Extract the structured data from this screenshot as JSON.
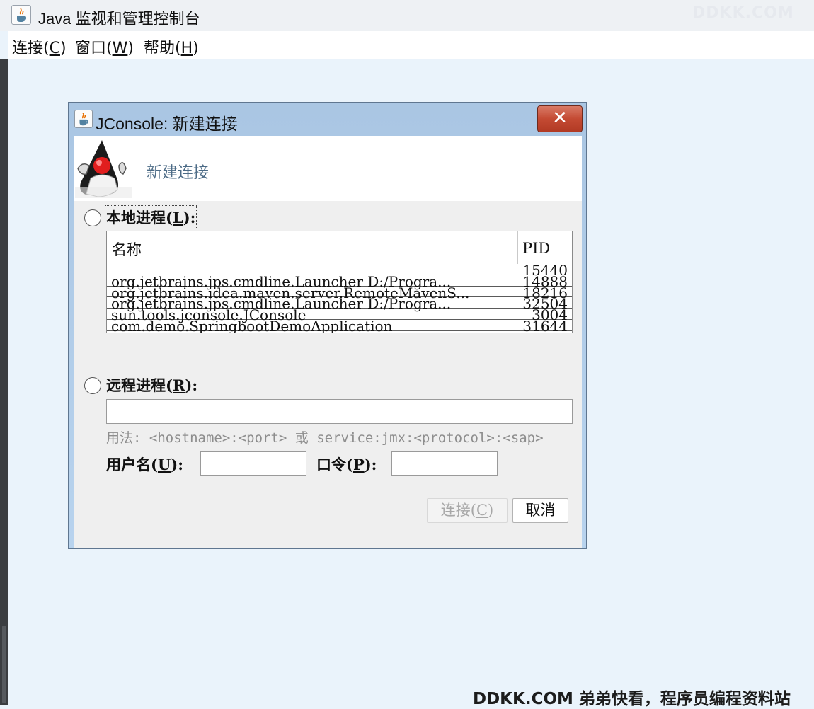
{
  "window": {
    "title": "Java 监视和管理控制台",
    "watermark_top": "DDKK.COM"
  },
  "menubar": {
    "items": [
      {
        "text": "连接(",
        "mnemonic": "C",
        "close": ")"
      },
      {
        "text": "窗口(",
        "mnemonic": "W",
        "close": ")"
      },
      {
        "text": "帮助(",
        "mnemonic": "H",
        "close": ")"
      }
    ]
  },
  "dialog": {
    "title": "JConsole: 新建连接",
    "close_glyph": "✕",
    "header_title": "新建连接",
    "local": {
      "label_pre": "本地进程(",
      "mnemonic": "L",
      "label_post": "):",
      "columns": {
        "name": "名称",
        "pid": "PID"
      },
      "rows": [
        {
          "name": "",
          "pid": "15440"
        },
        {
          "name": "org.jetbrains.jps.cmdline.Launcher D:/Progra...",
          "pid": "14888"
        },
        {
          "name": "org.jetbrains.idea.maven.server.RemoteMavenS...",
          "pid": "18216"
        },
        {
          "name": "org.jetbrains.jps.cmdline.Launcher D:/Progra...",
          "pid": "32504"
        },
        {
          "name": "sun.tools.jconsole.JConsole",
          "pid": "3004"
        },
        {
          "name": "com.demo.SpringbootDemoApplication",
          "pid": "31644"
        }
      ]
    },
    "remote": {
      "label_pre": "远程进程(",
      "mnemonic": "R",
      "label_post": "):",
      "url_value": "",
      "usage": "用法: <hostname>:<port> 或 service:jmx:<protocol>:<sap>",
      "username_pre": "用户名(",
      "username_mnemonic": "U",
      "username_post": "):",
      "username_value": "",
      "password_pre": "口令(",
      "password_mnemonic": "P",
      "password_post": "):",
      "password_value": ""
    },
    "buttons": {
      "connect_pre": "连接(",
      "connect_mnemonic": "C",
      "connect_post": ")",
      "cancel": "取消"
    }
  },
  "footer_watermark": "DDKK.COM 弟弟快看，程序员编程资料站",
  "colors": {
    "desktop": "#eaf3fb",
    "dialog_frame": "#b0cbe8",
    "close_button": "#c44a33",
    "header_title": "#4c6b86"
  }
}
